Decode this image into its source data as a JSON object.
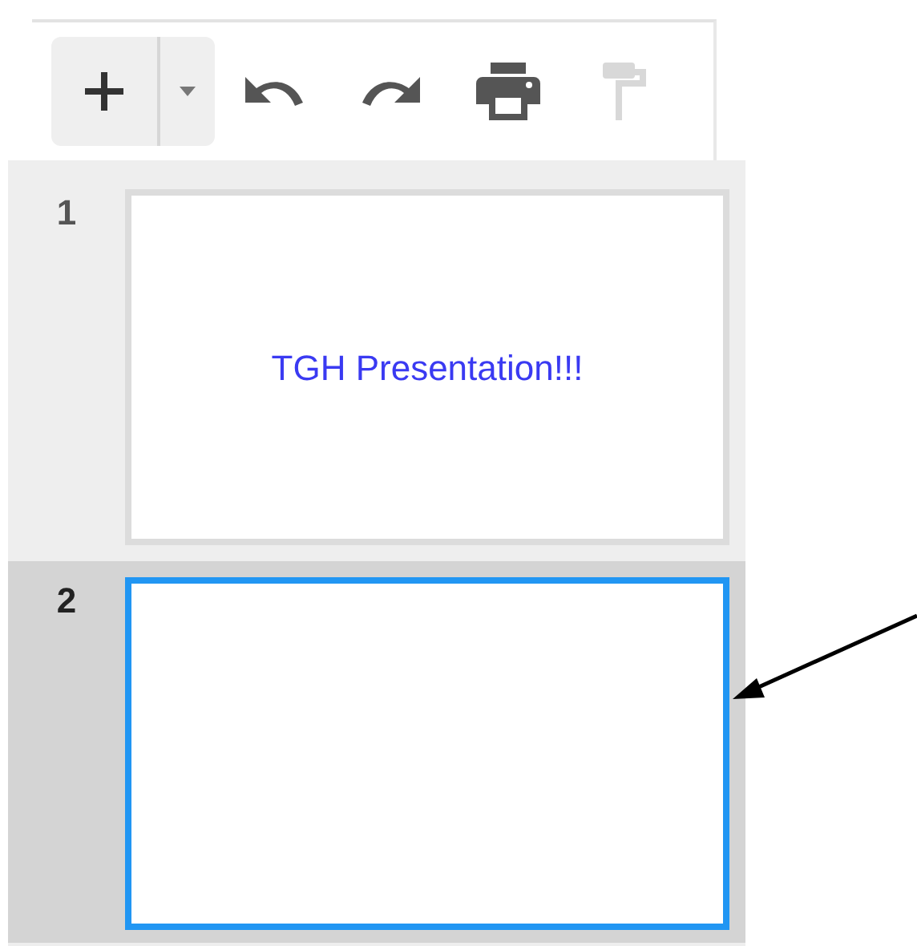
{
  "toolbar": {
    "buttons": [
      {
        "kind": "new-slide",
        "disabled": false
      },
      {
        "kind": "dropdown",
        "disabled": false
      },
      {
        "kind": "undo",
        "disabled": false
      },
      {
        "kind": "redo",
        "disabled": false
      },
      {
        "kind": "print",
        "disabled": false
      },
      {
        "kind": "paint-format",
        "disabled": true
      }
    ]
  },
  "slides": [
    {
      "number": "1",
      "title": "TGH Presentation!!!",
      "selected": false
    },
    {
      "number": "2",
      "selected": true
    }
  ]
}
